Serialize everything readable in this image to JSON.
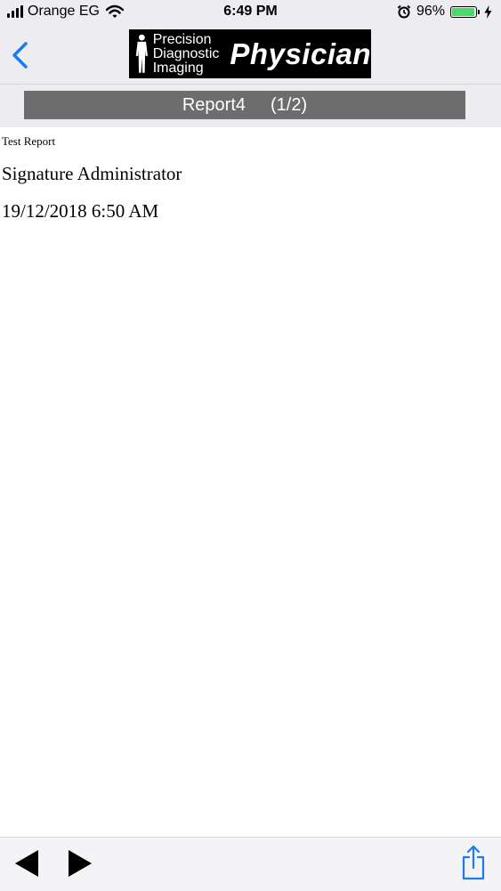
{
  "status_bar": {
    "carrier": "Orange EG",
    "time": "6:49 PM",
    "battery_percent": "96%",
    "battery_level": 0.96,
    "icons": [
      "signal-icon",
      "wifi-icon",
      "alarm-icon",
      "battery-icon",
      "charging-icon"
    ]
  },
  "navbar": {
    "back_icon": "chevron-left-icon",
    "logo": {
      "line1": "Precision",
      "line2": "Diagnostic",
      "line3": "Imaging",
      "big": "Physician"
    }
  },
  "report_bar": {
    "title": "Report4",
    "page": "(1/2)"
  },
  "report": {
    "title": "Test Report",
    "signature": "Signature Administrator",
    "date": "19/12/2018 6:50 AM"
  },
  "toolbar": {
    "icons": [
      "previous-icon",
      "next-icon",
      "share-icon"
    ]
  },
  "colors": {
    "accent": "#1a7cf0",
    "bar_background": "#ececf1",
    "report_bar": "#6d6d6d",
    "battery_fill": "#4cd964"
  }
}
